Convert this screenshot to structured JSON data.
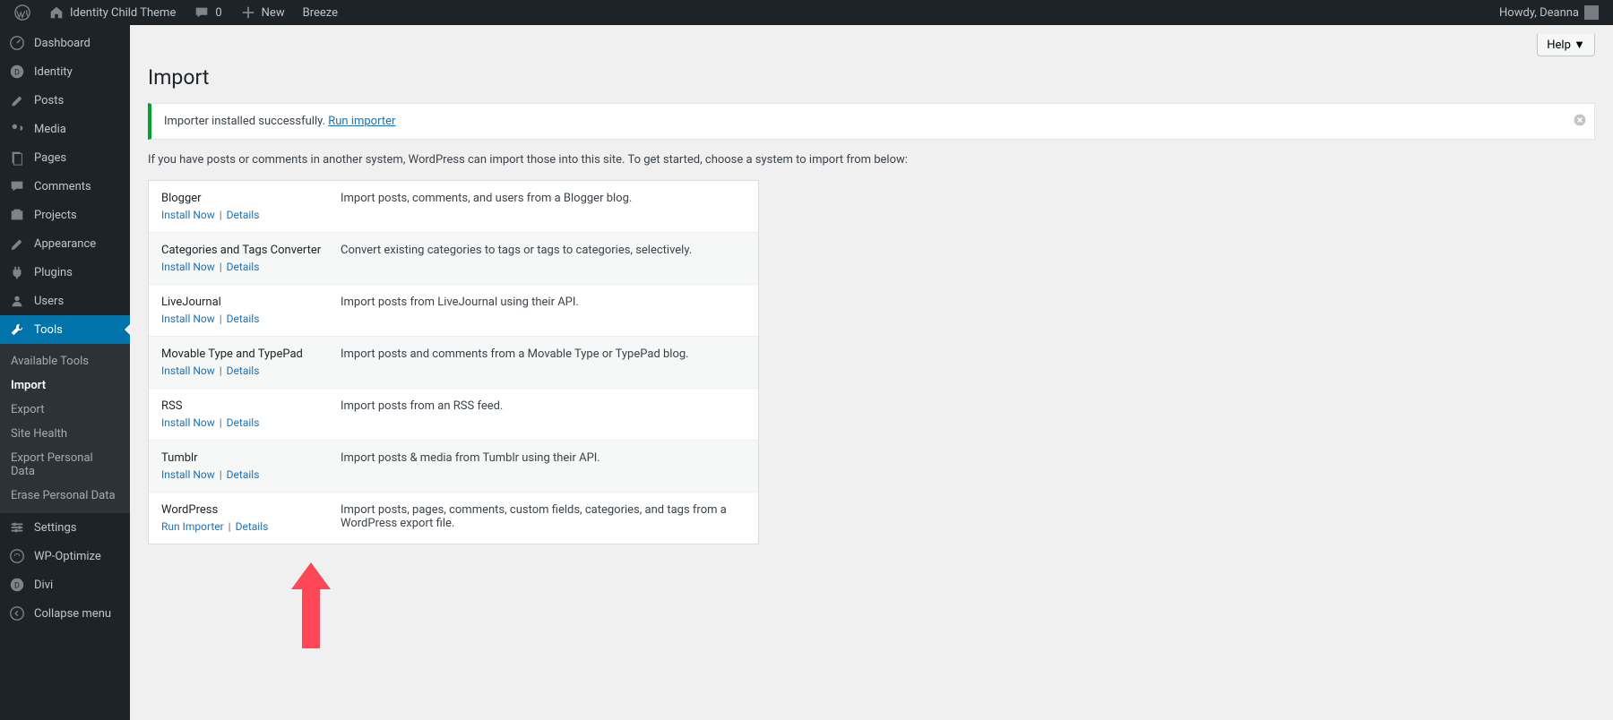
{
  "adminbar": {
    "site_name": "Identity Child Theme",
    "comments_count": "0",
    "new_label": "New",
    "breeze_label": "Breeze",
    "howdy": "Howdy, Deanna"
  },
  "sidebar": {
    "items": [
      {
        "icon": "dashboard",
        "label": "Dashboard"
      },
      {
        "icon": "identity",
        "label": "Identity"
      },
      {
        "icon": "posts",
        "label": "Posts"
      },
      {
        "icon": "media",
        "label": "Media"
      },
      {
        "icon": "pages",
        "label": "Pages"
      },
      {
        "icon": "comments",
        "label": "Comments"
      },
      {
        "icon": "projects",
        "label": "Projects"
      },
      {
        "icon": "appearance",
        "label": "Appearance"
      },
      {
        "icon": "plugins",
        "label": "Plugins"
      },
      {
        "icon": "users",
        "label": "Users"
      },
      {
        "icon": "tools",
        "label": "Tools",
        "current": true
      },
      {
        "icon": "settings",
        "label": "Settings"
      },
      {
        "icon": "wpo",
        "label": "WP-Optimize"
      },
      {
        "icon": "divi",
        "label": "Divi"
      },
      {
        "icon": "collapse",
        "label": "Collapse menu"
      }
    ],
    "submenu": [
      {
        "label": "Available Tools"
      },
      {
        "label": "Import",
        "active": true
      },
      {
        "label": "Export"
      },
      {
        "label": "Site Health"
      },
      {
        "label": "Export Personal Data"
      },
      {
        "label": "Erase Personal Data"
      }
    ]
  },
  "page": {
    "help_label": "Help ▼",
    "title": "Import",
    "notice_text": "Importer installed successfully. ",
    "notice_link": "Run importer",
    "intro": "If you have posts or comments in another system, WordPress can import those into this site. To get started, choose a system to import from below:"
  },
  "importers": [
    {
      "name": "Blogger",
      "desc": "Import posts, comments, and users from a Blogger blog.",
      "actions": [
        "Install Now",
        "Details"
      ]
    },
    {
      "name": "Categories and Tags Converter",
      "desc": "Convert existing categories to tags or tags to categories, selectively.",
      "actions": [
        "Install Now",
        "Details"
      ]
    },
    {
      "name": "LiveJournal",
      "desc": "Import posts from LiveJournal using their API.",
      "actions": [
        "Install Now",
        "Details"
      ]
    },
    {
      "name": "Movable Type and TypePad",
      "desc": "Import posts and comments from a Movable Type or TypePad blog.",
      "actions": [
        "Install Now",
        "Details"
      ]
    },
    {
      "name": "RSS",
      "desc": "Import posts from an RSS feed.",
      "actions": [
        "Install Now",
        "Details"
      ]
    },
    {
      "name": "Tumblr",
      "desc": "Import posts & media from Tumblr using their API.",
      "actions": [
        "Install Now",
        "Details"
      ]
    },
    {
      "name": "WordPress",
      "desc": "Import posts, pages, comments, custom fields, categories, and tags from a WordPress export file.",
      "actions": [
        "Run Importer",
        "Details"
      ]
    }
  ]
}
